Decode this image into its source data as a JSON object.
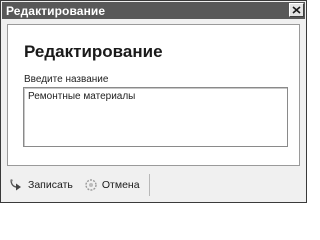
{
  "window": {
    "title": "Редактирование",
    "close_icon": "close-icon"
  },
  "content": {
    "heading": "Редактирование",
    "field_label": "Введите название",
    "field_value": "Ремонтные материалы"
  },
  "toolbar": {
    "save_label": "Записать",
    "save_icon": "save-arrow-icon",
    "cancel_label": "Отмена",
    "cancel_icon": "cancel-icon"
  },
  "colors": {
    "titlebar": "#585858",
    "panel": "#ffffff",
    "frame": "#f0f0f0"
  }
}
